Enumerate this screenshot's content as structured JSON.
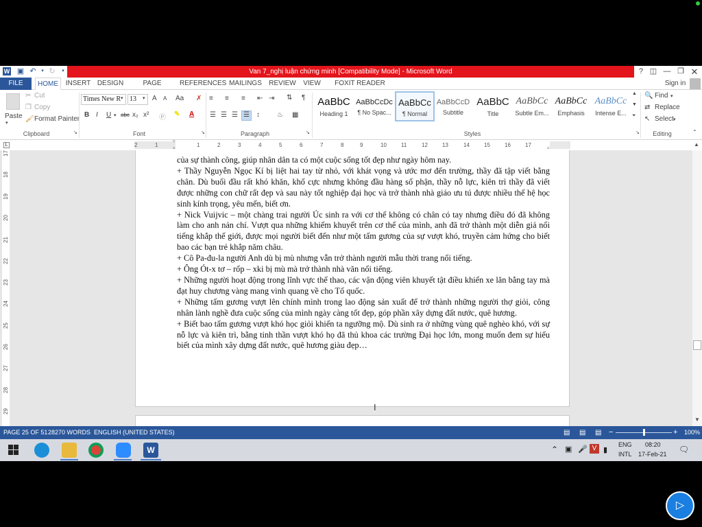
{
  "window": {
    "title": "Van 7_nghị luận chứng minh [Compatibility Mode] - Microsoft Word",
    "help": "?",
    "sign_in": "Sign in"
  },
  "tabs": [
    "FILE",
    "HOME",
    "INSERT",
    "DESIGN",
    "PAGE LAYOUT",
    "REFERENCES",
    "MAILINGS",
    "REVIEW",
    "VIEW",
    "FOXIT READER PDF"
  ],
  "clipboard": {
    "paste": "Paste",
    "cut": "Cut",
    "copy": "Copy",
    "format_painter": "Format Painter",
    "label": "Clipboard"
  },
  "font": {
    "name": "Times New R",
    "size": "13",
    "label": "Font",
    "bold": "B",
    "italic": "I",
    "underline": "U",
    "strike": "abc",
    "sub": "x₂",
    "sup": "x²",
    "grow": "A",
    "shrink": "A",
    "change_case": "Aa",
    "font_color": "A"
  },
  "paragraph": {
    "label": "Paragraph",
    "pilcrow": "¶"
  },
  "styles": {
    "label": "Styles",
    "items": [
      {
        "preview": "AaBbC",
        "name": "Heading 1"
      },
      {
        "preview": "AaBbCcDc",
        "name": "¶ No Spac..."
      },
      {
        "preview": "AaBbCc",
        "name": "¶ Normal"
      },
      {
        "preview": "AaBbCcD",
        "name": "Subtitle"
      },
      {
        "preview": "AaBbC",
        "name": "Title"
      },
      {
        "preview": "AaBbCc",
        "name": "Subtle Em..."
      },
      {
        "preview": "AaBbCc",
        "name": "Emphasis"
      },
      {
        "preview": "AaBbCc",
        "name": "Intense E..."
      }
    ]
  },
  "editing": {
    "label": "Editing",
    "find": "Find",
    "replace": "Replace",
    "select": "Select"
  },
  "ruler": {
    "h": [
      "2",
      "1",
      "1",
      "2",
      "3",
      "4",
      "5",
      "6",
      "7",
      "8",
      "9",
      "10",
      "11",
      "12",
      "13",
      "14",
      "15",
      "16",
      "17"
    ],
    "v": [
      "17",
      "18",
      "19",
      "20",
      "21",
      "22",
      "23",
      "24",
      "25",
      "26",
      "27",
      "28",
      "29"
    ]
  },
  "document": {
    "paragraphs": [
      "của sự thành công, giúp nhân dân ta có một cuộc sống tốt đẹp như ngày hôm nay.",
      "+ Thầy Nguyễn Ngọc Kí bị liệt hai tay từ nhỏ, với khát vọng và ước mơ đến trường, thầy đã tập viết bằng chân. Dù buổi đầu rất khó khăn, khổ cực nhưng không đầu hàng số phận, thầy nỗ lực, kiên trì thầy đã viết được những con chữ rất đẹp và sau này tốt nghiệp đại học và trở thành nhà giáo ưu tú được nhiều thế hệ học sinh kính trọng, yêu mến, biết ơn.",
      "+ Nick Vuijvic – một chàng trai người Úc sinh ra với cơ thể không có chân có tay nhưng điều đó đã không làm cho anh nản chí. Vượt qua những khiếm khuyết trên cơ thể của mình, anh đã trở thành một diễn giả nổi tiếng khắp thế giới, được mọi người biết đến như một tấm gương của sự vượt khó, truyền cảm hứng cho biết bao các bạn trẻ khắp năm châu.",
      "+ Cô Pa-đu-la người Anh dù bị mù nhưng vẫn trở thành người mẫu thời trang nổi tiếng.",
      "+ Ông Ót-x tơ – rốp – xki bị mù mà trở thành nhà văn nổi tiếng.",
      "+ Những người hoạt động trong lĩnh vực thể thao, các vận động viên khuyết tật điều khiển xe lăn bằng tay mà đạt huy chương vàng mang vinh quang về cho Tổ quốc.",
      "+ Những tấm gương vượt lên chính mình trong lao động sản xuất để trở thành những người thợ giỏi, công nhân lành nghề đưa cuộc sống của mình ngày càng tốt đẹp, góp phần xây dựng đất nước, quê hương.",
      "+ Biết bao tấm gương vượt khó học giỏi khiến ta ngưỡng mộ. Dù sinh ra ở những vùng quê nghèo khó, với sự nỗ lực và kiên trì, bằng tinh thần vượt khó họ đã thủ khoa các trường Đại học lớn, mong muốn đem sự hiểu biết của mình xây dựng đất nước, quê hương giàu đẹp…"
    ]
  },
  "status": {
    "page": "PAGE 25 OF 51",
    "words": "28270 WORDS",
    "language": "ENGLISH (UNITED STATES)",
    "zoom": "100%",
    "zoom_level": 1.0
  },
  "taskbar": {
    "lang": "ENG",
    "layout": "INTL",
    "time": "08:20",
    "date": "17-Feb-21"
  },
  "colors": {
    "word_blue": "#2b579a",
    "title_red": "#e3141b"
  }
}
